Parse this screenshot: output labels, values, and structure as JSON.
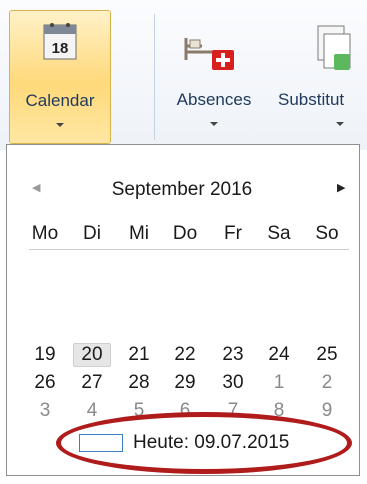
{
  "ribbon": {
    "calendar_label": "Calendar",
    "absences_label": "Absences",
    "substitutions_label": "Substitut",
    "calendar_icon_day": "18"
  },
  "calendar": {
    "month_title": "September 2016",
    "weekdays": [
      "Mo",
      "Di",
      "Mi",
      "Do",
      "Fr",
      "Sa",
      "So"
    ],
    "weeks": [
      [
        "19",
        "20",
        "21",
        "22",
        "23",
        "24",
        "25"
      ],
      [
        "26",
        "27",
        "28",
        "29",
        "30",
        "1",
        "2"
      ],
      [
        "3",
        "4",
        "5",
        "6",
        "7",
        "8",
        "9"
      ]
    ],
    "today_label": "Heute: 09.07.2015"
  },
  "colors": {
    "ribbon_selected": "#ffd97a",
    "highlight_ellipse": "#b01c1c",
    "today_box_border": "#3c7fc7"
  }
}
